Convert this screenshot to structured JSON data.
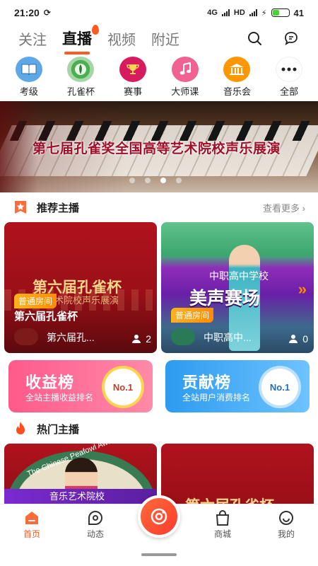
{
  "status": {
    "time": "21:20",
    "battery": "41",
    "net1": "4G",
    "net2": "HD"
  },
  "top_tabs": [
    "关注",
    "直播",
    "视频",
    "附近"
  ],
  "categories": [
    {
      "label": "考级",
      "icon": "book-icon",
      "color": "#5fa8e8"
    },
    {
      "label": "孔雀杯",
      "icon": "peacock-icon",
      "color": "#4caf50"
    },
    {
      "label": "赛事",
      "icon": "trophy-icon",
      "color": "#d81b60"
    },
    {
      "label": "大师课",
      "icon": "music-note-icon",
      "color": "#f06292"
    },
    {
      "label": "音乐会",
      "icon": "concert-icon",
      "color": "#ff9800"
    },
    {
      "label": "全部",
      "icon": "more-icon",
      "color": "#ffffff"
    }
  ],
  "banner": {
    "title": "第七届孔雀奖全国高等艺术院校声乐展演"
  },
  "recommended": {
    "title": "推荐主播",
    "see_more": "查看更多",
    "cards": [
      {
        "poster_line1": "第六届孔雀杯",
        "poster_line2": "艺术院校声乐展演",
        "tag": "普通房间",
        "title": "第六届孔雀杯",
        "anchor": "第六届孔...",
        "viewers": "2"
      },
      {
        "poster_line1": "中职高中学校",
        "poster_line2": "美声赛场",
        "tag": "普通房间",
        "title": "",
        "anchor": "中职高中...",
        "viewers": "0"
      }
    ]
  },
  "ranks": [
    {
      "title": "收益榜",
      "subtitle": "全站主播收益排名",
      "badge": "No.1"
    },
    {
      "title": "贡献榜",
      "subtitle": "全站用户消费排名",
      "badge": "No.1"
    }
  ],
  "hot": {
    "title": "热门主播",
    "cards": [
      {
        "ring_text": "The Chinese Peafowl Award",
        "caption": "音乐艺术院校"
      },
      {
        "caption": "第六届孔雀杯"
      }
    ]
  },
  "bottom_nav": [
    "首页",
    "动态",
    "商城",
    "我的"
  ]
}
